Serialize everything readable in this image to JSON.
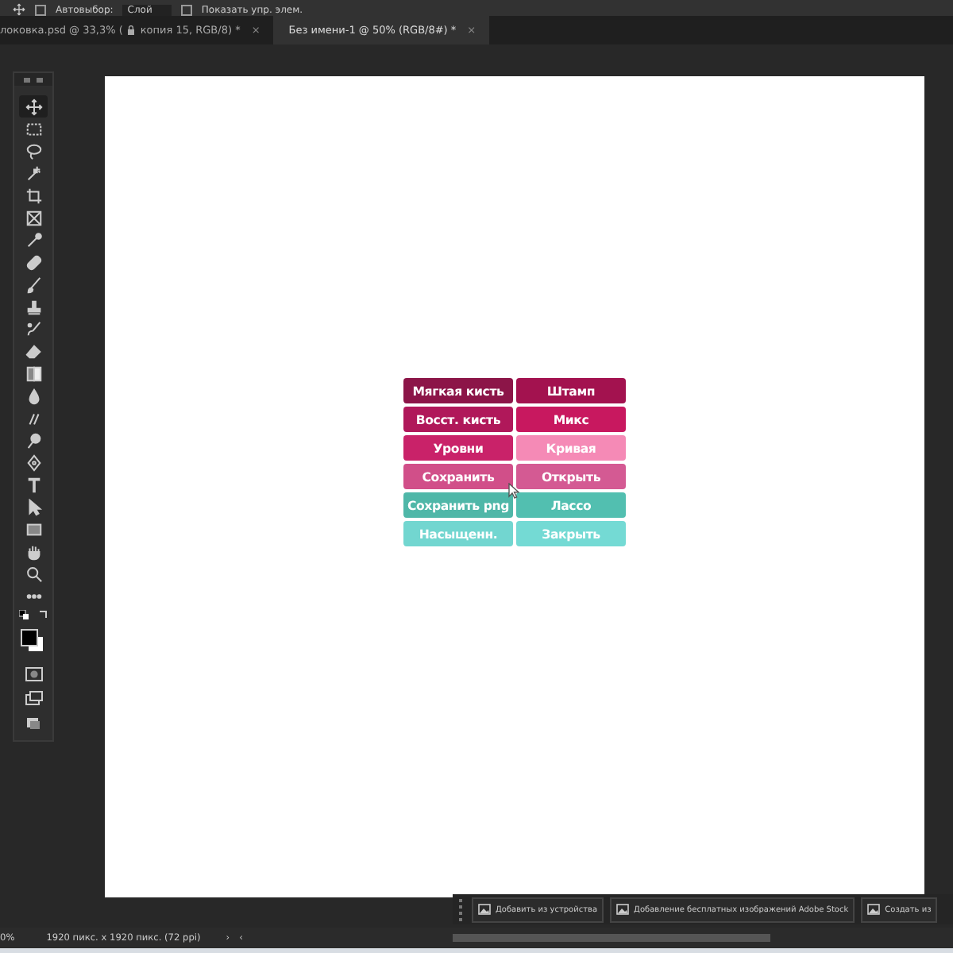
{
  "options_bar": {
    "auto_select": {
      "label": "Автовыбор:",
      "checked": false
    },
    "target": "Слой",
    "show_controls": {
      "label": "Показать упр. элем.",
      "checked": false
    }
  },
  "document_tabs": [
    {
      "label": "локовка.psd @ 33,3% (",
      "label_after_lock": "копия 15, RGB/8) *",
      "close": "×",
      "selected": false
    },
    {
      "label": "Без имени-1 @ 50% (RGB/8#) *",
      "close": "×",
      "selected": true
    }
  ],
  "toolbar": {
    "tools": [
      {
        "kind": "move",
        "selected": true
      },
      {
        "kind": "marquee",
        "selected": false
      },
      {
        "kind": "lasso",
        "selected": false
      },
      {
        "kind": "wand",
        "selected": false
      },
      {
        "kind": "crop",
        "selected": false
      },
      {
        "kind": "frame",
        "selected": false
      },
      {
        "kind": "eyedropper",
        "selected": false
      },
      {
        "kind": "healing",
        "selected": false
      },
      {
        "kind": "brush",
        "selected": false
      },
      {
        "kind": "stamp",
        "selected": false
      },
      {
        "kind": "history",
        "selected": false
      },
      {
        "kind": "eraser",
        "selected": false
      },
      {
        "kind": "gradient",
        "selected": false
      },
      {
        "kind": "drop",
        "selected": false
      },
      {
        "kind": "smudge",
        "selected": false
      },
      {
        "kind": "dodge",
        "selected": false
      },
      {
        "kind": "pen",
        "selected": false
      },
      {
        "kind": "type",
        "selected": false
      },
      {
        "kind": "pointer",
        "selected": false
      },
      {
        "kind": "rectangle",
        "selected": false
      },
      {
        "kind": "hand",
        "selected": false
      },
      {
        "kind": "zoom",
        "selected": false
      },
      {
        "kind": "more",
        "selected": false
      }
    ]
  },
  "canvas_buttons": [
    {
      "label": "Мягкая кисть",
      "color": "#8c1548"
    },
    {
      "label": "Штамп",
      "color": "#a3124f"
    },
    {
      "label": "Восст. кисть",
      "color": "#b0185a"
    },
    {
      "label": "Микс",
      "color": "#c8185f"
    },
    {
      "label": "Уровни",
      "color": "#c92269"
    },
    {
      "label": "Кривая",
      "color": "#f58ab6"
    },
    {
      "label": "Сохранить",
      "color": "#d14f89"
    },
    {
      "label": "Открыть",
      "color": "#d45a93"
    },
    {
      "label": "Сохранить png",
      "color": "#4fb7a8"
    },
    {
      "label": "Лассо",
      "color": "#52bfb0"
    },
    {
      "label": "Насыщенн.",
      "color": "#72d6d0"
    },
    {
      "label": "Закрыть",
      "color": "#74dad4"
    }
  ],
  "taskbar": [
    "Добавить из устройства",
    "Добавление бесплатных изображений Adobe Stock",
    "Создать из"
  ],
  "status_bar": {
    "zoom": "0%",
    "info": "1920 пикс. x 1920 пикс. (72 ppi)",
    "next": "›",
    "prev": "‹"
  }
}
